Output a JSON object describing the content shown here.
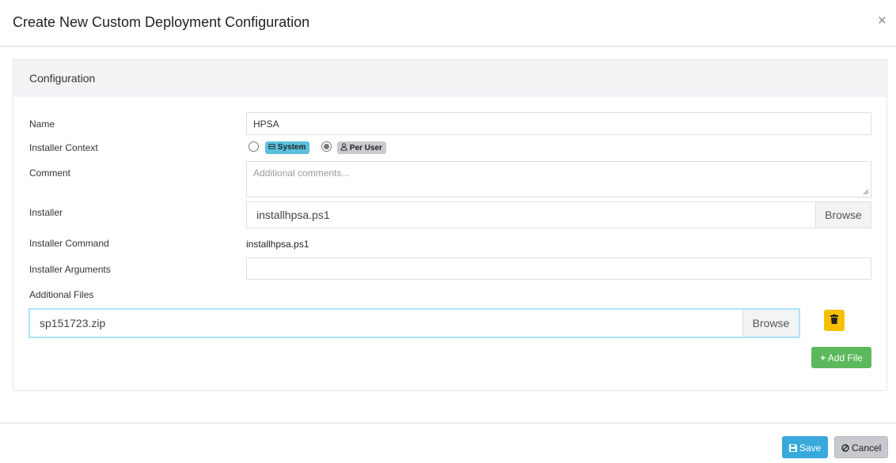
{
  "dialog": {
    "title": "Create New Custom Deployment Configuration",
    "close_label": "×"
  },
  "panel": {
    "heading": "Configuration"
  },
  "form": {
    "name_label": "Name",
    "name_value": "HPSA",
    "context_label": "Installer Context",
    "context_options": [
      {
        "label": "System",
        "icon": "system-icon",
        "selected": false
      },
      {
        "label": "Per User",
        "icon": "user-icon",
        "selected": true
      }
    ],
    "comment_label": "Comment",
    "comment_placeholder": "Additional comments...",
    "installer_label": "Installer",
    "installer_file": "installhpsa.ps1",
    "installer_browse": "Browse",
    "command_label": "Installer Command",
    "command_value": "installhpsa.ps1",
    "arguments_label": "Installer Arguments",
    "arguments_value": "",
    "additional_label": "Additional Files",
    "additional_file": "sp151723.zip",
    "additional_browse": "Browse",
    "add_file_label": "Add File"
  },
  "footer": {
    "save_label": "Save",
    "cancel_label": "Cancel"
  },
  "colors": {
    "system_badge": "#5bc0de",
    "user_badge": "#c9cbcf",
    "delete_button": "#f5c000",
    "add_button": "#5cb85c",
    "save_button": "#39a9dc",
    "cancel_button": "#c6c9cd"
  }
}
